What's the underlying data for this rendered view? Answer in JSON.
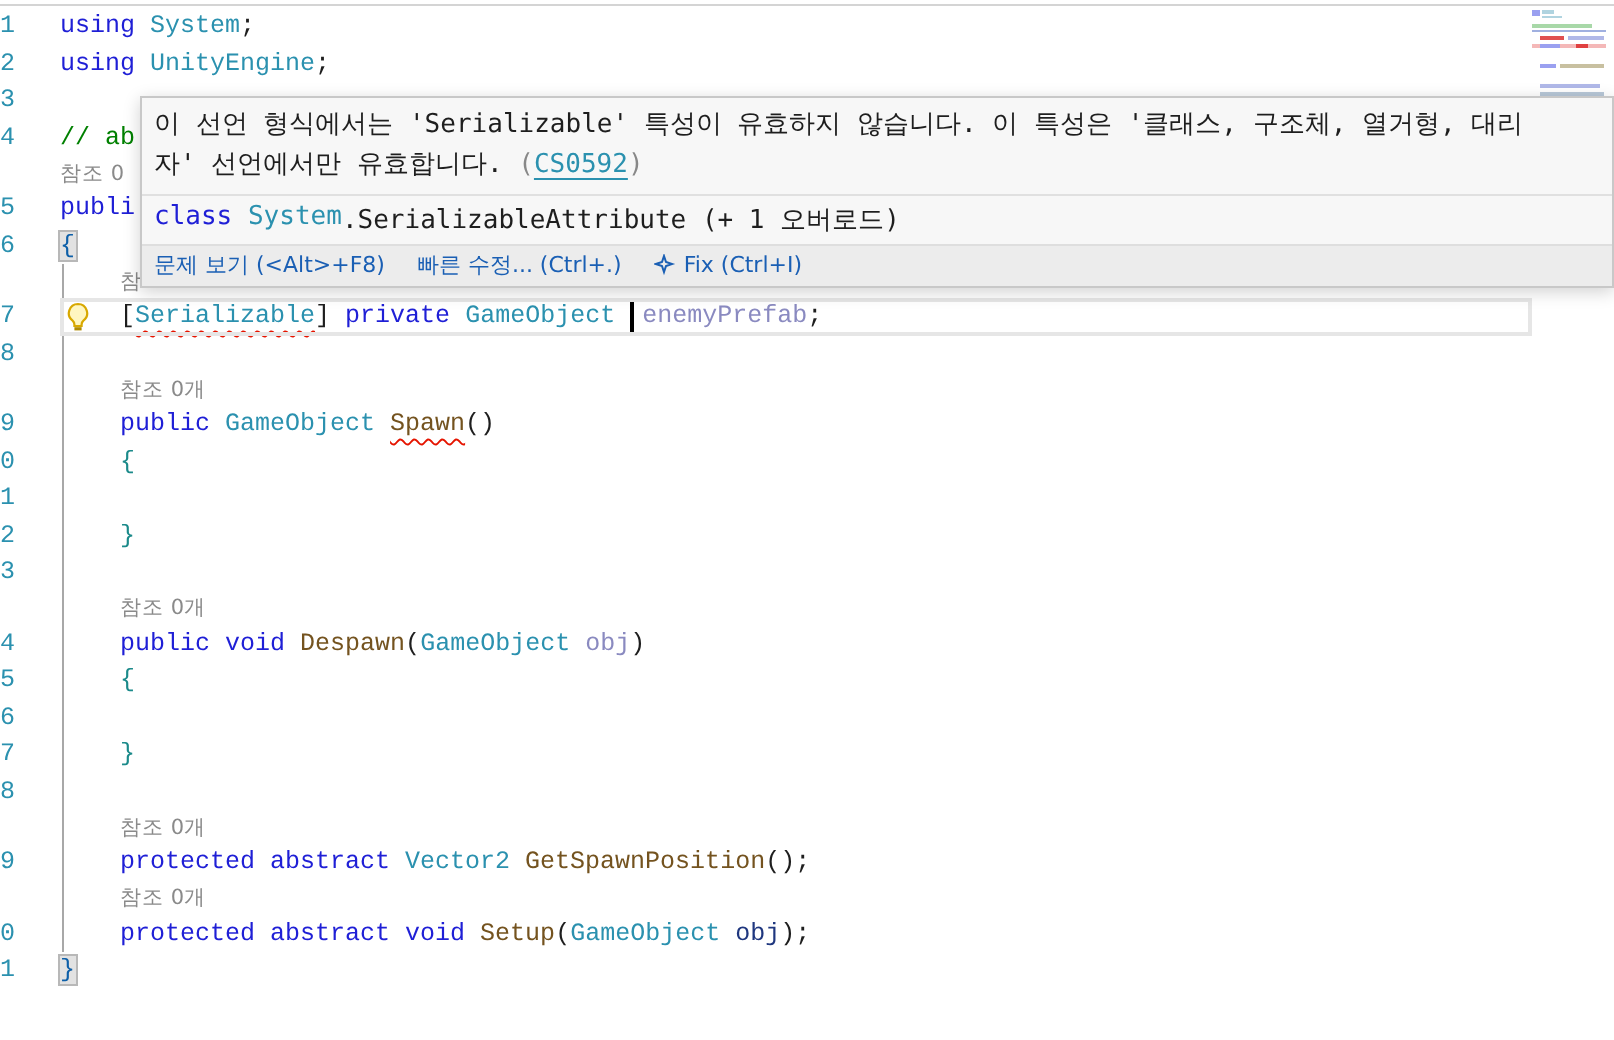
{
  "lines": [
    {
      "kind": "code",
      "number": "1",
      "tokens": [
        {
          "text": "using ",
          "kind": "keyword"
        },
        {
          "text": "System",
          "kind": "type"
        },
        {
          "text": ";",
          "kind": "plain"
        }
      ]
    },
    {
      "kind": "code",
      "number": "2",
      "tokens": [
        {
          "text": "using ",
          "kind": "keyword"
        },
        {
          "text": "UnityEngine",
          "kind": "type"
        },
        {
          "text": ";",
          "kind": "plain"
        }
      ]
    },
    {
      "kind": "code",
      "number": "3"
    },
    {
      "kind": "code",
      "number": "4",
      "tokens": [
        {
          "text": "// ab",
          "kind": "comment"
        }
      ]
    },
    {
      "kind": "lens",
      "text": "참조 0"
    },
    {
      "kind": "code",
      "number": "5",
      "tokens": [
        {
          "text": "publi",
          "kind": "keyword"
        }
      ]
    },
    {
      "kind": "code",
      "number": "6",
      "tokens": [
        {
          "text": "{",
          "kind": "match"
        }
      ]
    },
    {
      "kind": "lens",
      "text": "참",
      "indented": true
    },
    {
      "kind": "code",
      "number": "7",
      "indented": true,
      "current": true,
      "lightbulb": true,
      "tokens": [
        {
          "text": "[",
          "kind": "plain"
        },
        {
          "text": "Serializable",
          "kind": "type",
          "squiggle": true
        },
        {
          "text": "] ",
          "kind": "plain"
        },
        {
          "text": "private ",
          "kind": "keyword"
        },
        {
          "text": "GameObject ",
          "kind": "type"
        },
        {
          "kind": "caret"
        },
        {
          "text": "enemyPrefab",
          "kind": "unused"
        },
        {
          "text": ";",
          "kind": "plain"
        }
      ]
    },
    {
      "kind": "code",
      "number": "8",
      "indented": true
    },
    {
      "kind": "lens",
      "text": "참조 0개",
      "indented": true
    },
    {
      "kind": "code",
      "number": "9",
      "indented": true,
      "tokens": [
        {
          "text": "public ",
          "kind": "keyword"
        },
        {
          "text": "GameObject ",
          "kind": "type"
        },
        {
          "text": "Spawn",
          "kind": "method",
          "squiggle": true
        },
        {
          "text": "()",
          "kind": "plain"
        }
      ]
    },
    {
      "kind": "code",
      "number": "0",
      "indented": true,
      "tokens": [
        {
          "text": "{",
          "kind": "brace"
        }
      ]
    },
    {
      "kind": "code",
      "number": "1",
      "indented": true
    },
    {
      "kind": "code",
      "number": "2",
      "indented": true,
      "tokens": [
        {
          "text": "}",
          "kind": "brace"
        }
      ]
    },
    {
      "kind": "code",
      "number": "3",
      "indented": true
    },
    {
      "kind": "lens",
      "text": "참조 0개",
      "indented": true
    },
    {
      "kind": "code",
      "number": "4",
      "indented": true,
      "tokens": [
        {
          "text": "public ",
          "kind": "keyword"
        },
        {
          "text": "void ",
          "kind": "keyword"
        },
        {
          "text": "Despawn",
          "kind": "method"
        },
        {
          "text": "(",
          "kind": "plain"
        },
        {
          "text": "GameObject ",
          "kind": "type"
        },
        {
          "text": "obj",
          "kind": "unused"
        },
        {
          "text": ")",
          "kind": "plain"
        }
      ]
    },
    {
      "kind": "code",
      "number": "5",
      "indented": true,
      "tokens": [
        {
          "text": "{",
          "kind": "brace"
        }
      ]
    },
    {
      "kind": "code",
      "number": "6",
      "indented": true
    },
    {
      "kind": "code",
      "number": "7",
      "indented": true,
      "tokens": [
        {
          "text": "}",
          "kind": "brace"
        }
      ]
    },
    {
      "kind": "code",
      "number": "8",
      "indented": true
    },
    {
      "kind": "lens",
      "text": "참조 0개",
      "indented": true
    },
    {
      "kind": "code",
      "number": "9",
      "indented": true,
      "tokens": [
        {
          "text": "protected ",
          "kind": "keyword"
        },
        {
          "text": "abstract ",
          "kind": "keyword"
        },
        {
          "text": "Vector2 ",
          "kind": "type"
        },
        {
          "text": "GetSpawnPosition",
          "kind": "method"
        },
        {
          "text": "();",
          "kind": "plain"
        }
      ]
    },
    {
      "kind": "lens",
      "text": "참조 0개",
      "indented": true
    },
    {
      "kind": "code",
      "number": "0",
      "indented": true,
      "tokens": [
        {
          "text": "protected ",
          "kind": "keyword"
        },
        {
          "text": "abstract ",
          "kind": "keyword"
        },
        {
          "text": "void ",
          "kind": "keyword"
        },
        {
          "text": "Setup",
          "kind": "method"
        },
        {
          "text": "(",
          "kind": "plain"
        },
        {
          "text": "GameObject ",
          "kind": "type"
        },
        {
          "text": "obj",
          "kind": "param"
        },
        {
          "text": ");",
          "kind": "plain"
        }
      ]
    },
    {
      "kind": "code",
      "number": "1",
      "tokens": [
        {
          "text": "}",
          "kind": "match"
        }
      ]
    }
  ],
  "popup": {
    "message": "이 선언 형식에서는 'Serializable' 특성이 유효하지 않습니다. 이 특성은 '클래스, 구조체, 열거형, 대리자' 선언에서만 유효합니다.",
    "code_open": "(",
    "code": "CS0592",
    "code_close": ")",
    "signature": [
      {
        "text": "class ",
        "kind": "keyword"
      },
      {
        "text": "System",
        "kind": "type"
      },
      {
        "text": ".SerializableAttribute (+ 1 오버로드)",
        "kind": "plain"
      }
    ],
    "actions": [
      {
        "kind": "text",
        "label": "문제 보기 (<Alt>+F8)"
      },
      {
        "kind": "text",
        "label": "빠른 수정... (Ctrl+.)"
      },
      {
        "kind": "sparkle",
        "label": "Fix (Ctrl+I)"
      }
    ]
  }
}
